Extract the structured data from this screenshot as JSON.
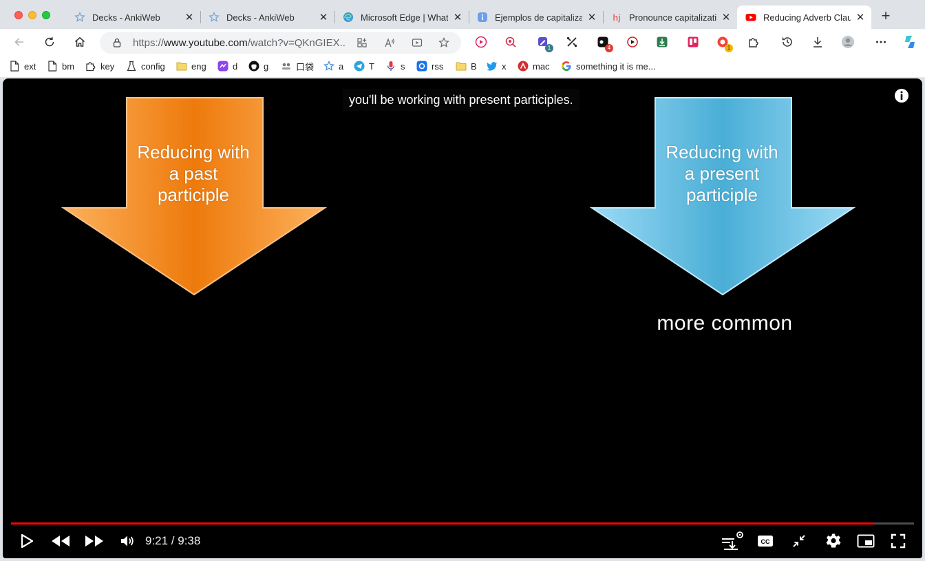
{
  "tabs": [
    {
      "title": "Decks - AnkiWeb",
      "icon": "anki-star-icon"
    },
    {
      "title": "Decks - AnkiWeb",
      "icon": "anki-star-icon"
    },
    {
      "title": "Microsoft Edge | What",
      "icon": "edge-icon"
    },
    {
      "title": "Ejemplos de capitalizat",
      "icon": "info-icon"
    },
    {
      "title": "Pronounce capitalizatio",
      "icon": "hj-icon"
    },
    {
      "title": "Reducing Adverb Claus",
      "icon": "youtube-icon",
      "active": true
    }
  ],
  "toolbar": {
    "url_prefix": "https://",
    "url_host": "www.youtube.com",
    "url_rest": "/watch?v=QKnGIEX...",
    "badges": {
      "ext2": "1",
      "ext5": "4",
      "ext10": "1"
    }
  },
  "bookmarks": [
    {
      "label": "ext",
      "icon": "page-icon"
    },
    {
      "label": "bm",
      "icon": "page-icon"
    },
    {
      "label": "key",
      "icon": "puzzle-icon"
    },
    {
      "label": "config",
      "icon": "flask-icon"
    },
    {
      "label": "eng",
      "icon": "folder-icon"
    },
    {
      "label": "d",
      "icon": "purple-app-icon"
    },
    {
      "label": "g",
      "icon": "github-icon"
    },
    {
      "label": "口袋",
      "icon": "pocket-icon"
    },
    {
      "label": "a",
      "icon": "anki-star-icon"
    },
    {
      "label": "T",
      "icon": "telegram-icon"
    },
    {
      "label": "s",
      "icon": "microphone-icon"
    },
    {
      "label": "rss",
      "icon": "rss-app-icon"
    },
    {
      "label": "B",
      "icon": "folder-icon"
    },
    {
      "label": "x",
      "icon": "twitter-icon"
    },
    {
      "label": "mac",
      "icon": "red-app-icon"
    },
    {
      "label": "something it is me...",
      "icon": "google-icon"
    }
  ],
  "video": {
    "caption": "you'll be working with present participles.",
    "left_arrow_text": [
      "Reducing with",
      "a past",
      "participle"
    ],
    "right_arrow_text": [
      "Reducing with",
      "a present",
      "participle"
    ],
    "annotation": "more common",
    "current_time": "9:21",
    "duration": "9:38",
    "time_display": "9:21 / 9:38",
    "progress_fraction": 0.955,
    "colors": {
      "left_arrow": "#f08a1e",
      "right_arrow": "#62b8e0",
      "progress": "#ff0000"
    }
  }
}
